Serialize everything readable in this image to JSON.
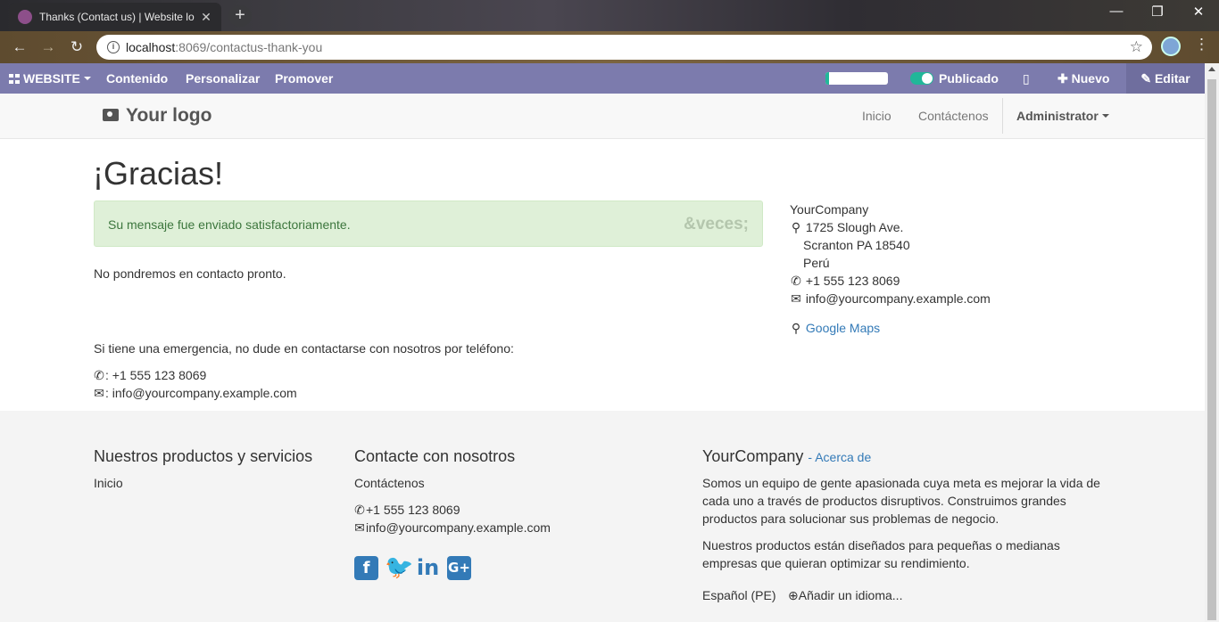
{
  "browser": {
    "tab_title": "Thanks (Contact us) | Website lo",
    "url_host": "localhost",
    "url_rest": ":8069/contactus-thank-you",
    "window_controls": [
      "—",
      "❐",
      "✕"
    ]
  },
  "adminbar": {
    "website": "WEBSITE",
    "content": "Contenido",
    "customize": "Personalizar",
    "promote": "Promover",
    "publish_progress": 0.05,
    "published": "Publicado",
    "new": "Nuevo",
    "edit": "Editar"
  },
  "header": {
    "logo": "Your logo",
    "nav": [
      "Inicio",
      "Contáctenos"
    ],
    "user": "Administrator"
  },
  "main": {
    "title": "¡Gracias!",
    "alert_message": "Su mensaje fue enviado satisfactoriamente.",
    "alert_close": "&veces;",
    "contact_soon": "No pondremos en contacto pronto.",
    "emergency": "Si tiene una emergencia, no dude en contactarse con nosotros por teléfono:",
    "phone_line": ": +1 555 123 8069",
    "email_line": ": info@yourcompany.example.com"
  },
  "company": {
    "name": "YourCompany",
    "street": "1725 Slough Ave.",
    "city": "Scranton PA 18540",
    "country": "Perú",
    "phone": "+1 555 123 8069",
    "email": "info@yourcompany.example.com",
    "maps": "Google Maps"
  },
  "footer": {
    "products_title": "Nuestros productos y servicios",
    "products_link": "Inicio",
    "contact_title": "Contacte con nosotros",
    "contact_link": "Contáctenos",
    "phone": "+1 555 123 8069",
    "email": "info@yourcompany.example.com",
    "about_company": "YourCompany",
    "about_link": "- Acerca de",
    "about_p1_l1": "Somos un equipo de gente apasionada cuya meta es mejorar la vida de",
    "about_p1_l2": "cada uno a través de productos disruptivos. Construimos grandes",
    "about_p1_l3": "productos para solucionar sus problemas de negocio.",
    "about_p2_l1": "Nuestros productos están diseñados para pequeñas o medianas",
    "about_p2_l2": "empresas que quieran optimizar su rendimiento.",
    "language": "Español (PE)",
    "add_language": "Añadir un idioma..."
  },
  "colors": {
    "adminbar": "#7c7bad",
    "link": "#337ab7",
    "alert_bg": "#dff0d8",
    "alert_text": "#3c763d",
    "published_toggle": "#21b799"
  }
}
